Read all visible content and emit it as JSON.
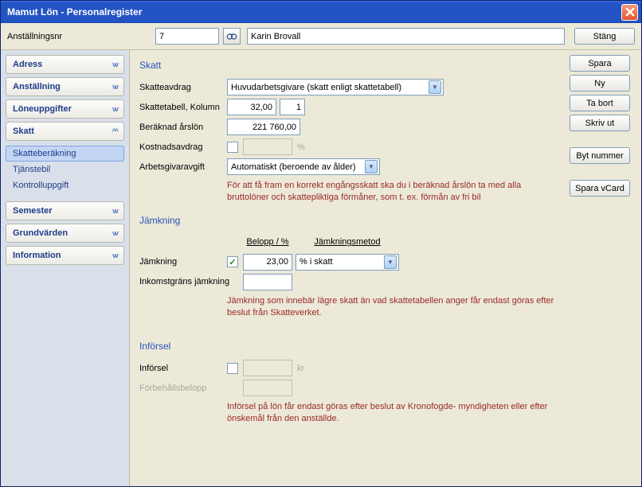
{
  "title": "Mamut Lön - Personalregister",
  "toolbar": {
    "id_label": "Anställningsnr",
    "id_value": "7",
    "name_value": "Karin Brovall",
    "close_label": "Stäng"
  },
  "sidebar": {
    "items": [
      {
        "label": "Adress",
        "expanded": false
      },
      {
        "label": "Anställning",
        "expanded": false
      },
      {
        "label": "Löneuppgifter",
        "expanded": false
      },
      {
        "label": "Skatt",
        "expanded": true,
        "children": [
          {
            "label": "Skatteberäkning",
            "selected": true
          },
          {
            "label": "Tjänstebil",
            "selected": false
          },
          {
            "label": "Kontrolluppgift",
            "selected": false
          }
        ]
      },
      {
        "label": "Semester",
        "expanded": false
      },
      {
        "label": "Grundvärden",
        "expanded": false
      },
      {
        "label": "Information",
        "expanded": false
      }
    ]
  },
  "right_buttons": {
    "save": "Spara",
    "new": "Ny",
    "delete": "Ta bort",
    "print": "Skriv ut",
    "change_number": "Byt nummer",
    "save_vcard": "Spara vCard"
  },
  "sections": {
    "skatt": {
      "title": "Skatt",
      "skatteavdrag_label": "Skatteavdrag",
      "skatteavdrag_value": "Huvudarbetsgivare (skatt enligt skattetabell)",
      "skattetabell_label": "Skattetabell, Kolumn",
      "skattetabell_value": "32,00",
      "kolumn_value": "1",
      "beraknad_label": "Beräknad årslön",
      "beraknad_value": "221 760,00",
      "kostnadsavdrag_label": "Kostnadsavdrag",
      "kostnadsavdrag_checked": false,
      "kostnadsavdrag_value": "",
      "kostnadsavdrag_unit": "%",
      "arbetsgivaravgift_label": "Arbetsgivaravgift",
      "arbetsgivaravgift_value": "Automatiskt (beroende av ålder)",
      "info": "För att få fram en korrekt engångsskatt ska du i beräknad årslön ta med alla bruttolöner och skattepliktiga förmåner, som t. ex. förmån av fri bil"
    },
    "jamkning": {
      "title": "Jämkning",
      "col_belopp": "Belopp / %",
      "col_metod": "Jämkningsmetod",
      "jamkning_label": "Jämkning",
      "jamkning_checked": true,
      "jamkning_value": "23,00",
      "jamkning_metod": "% i skatt",
      "inkomstgrans_label": "Inkomstgräns jämkning",
      "inkomstgrans_value": "",
      "info": "Jämkning som innebär lägre skatt än vad skattetabellen anger får endast göras efter beslut från Skatteverket."
    },
    "inforsel": {
      "title": "Införsel",
      "inforsel_label": "Införsel",
      "inforsel_checked": false,
      "inforsel_value": "",
      "inforsel_unit": "kr",
      "forbehall_label": "Förbehållsbelopp",
      "forbehall_value": "",
      "info": "Införsel på lön får endast göras efter beslut av Kronofogde- myndigheten eller efter önskemål från den anställde."
    }
  }
}
